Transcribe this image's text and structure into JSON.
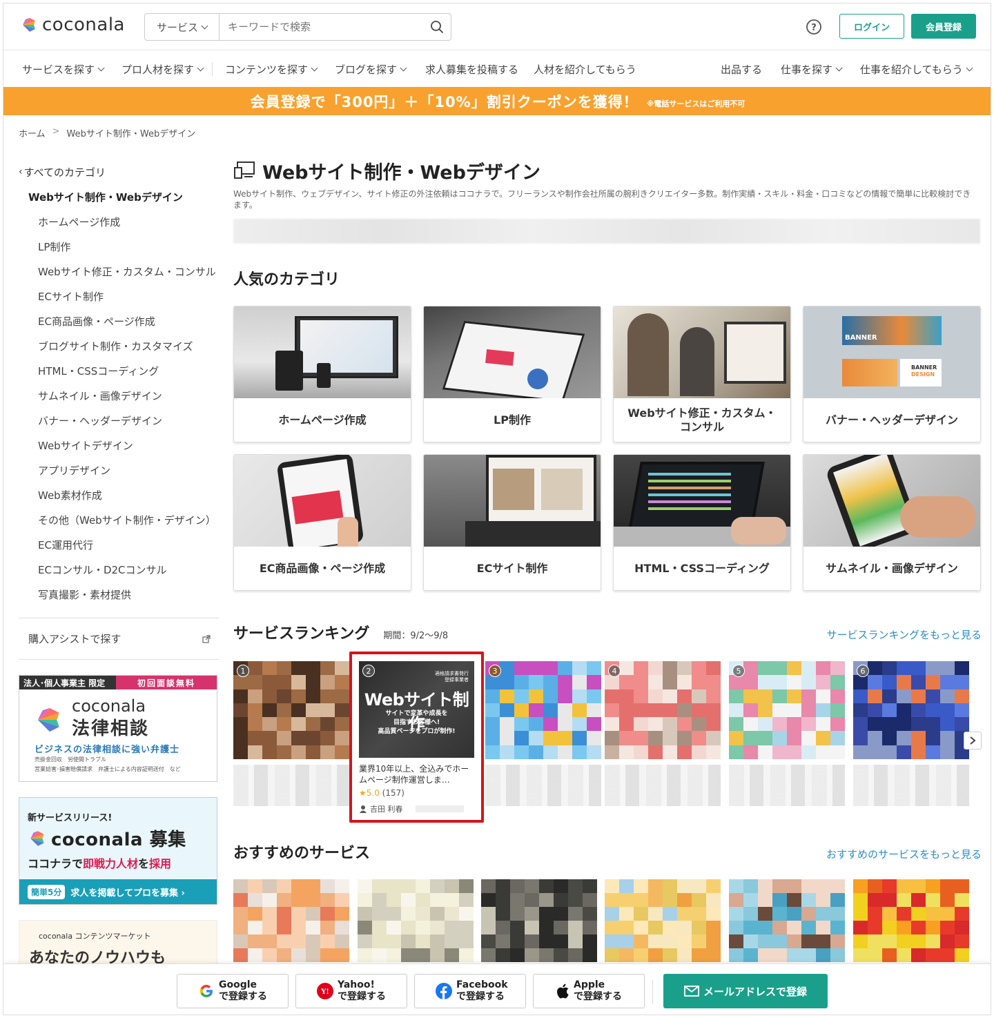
{
  "header": {
    "logo_text": "coconala",
    "search_category": "サービス",
    "search_placeholder": "キーワードで検索",
    "login_label": "ログイン",
    "signup_label": "会員登録"
  },
  "nav": {
    "items": [
      "サービスを探す",
      "プロ人材を探す",
      "コンテンツを探す",
      "ブログを探す",
      "求人募集を投稿する",
      "人材を紹介してもらう"
    ],
    "right_items": [
      "出品する",
      "仕事を探す",
      "仕事を紹介してもらう"
    ]
  },
  "promo": {
    "main": "会員登録で「300円」＋「10%」割引クーポンを獲得！",
    "note": "※電話サービスはご利用不可"
  },
  "breadcrumb": {
    "home": "ホーム",
    "sep": ">",
    "current": "Webサイト制作・Webデザイン"
  },
  "sidebar": {
    "back": "すべてのカテゴリ",
    "current": "Webサイト制作・Webデザイン",
    "items": [
      "ホームページ作成",
      "LP制作",
      "Webサイト修正・カスタム・コンサル",
      "ECサイト制作",
      "EC商品画像・ページ作成",
      "ブログサイト制作・カスタマイズ",
      "HTML・CSSコーディング",
      "サムネイル・画像デザイン",
      "バナー・ヘッダーデザイン",
      "Webサイトデザイン",
      "アプリデザイン",
      "Web素材作成",
      "その他（Webサイト制作・デザイン）",
      "EC運用代行",
      "ECコンサル・D2Cコンサル",
      "写真撮影・素材提供"
    ],
    "assist": "購入アシストで探す"
  },
  "ads": {
    "legal": {
      "tag_left": "法人･個人事業主 限定",
      "tag_right": "初回面談無料",
      "brand": "coconala",
      "title": "法律相談",
      "sub": "ビジネスの法律相談に強い弁護士",
      "small1": "売掛金回収　労使間トラブル",
      "small2": "営業妨害･損害賠償請求　弁護士による内容証明送付　など"
    },
    "recruit": {
      "t1": "新サービスリリース!",
      "brand": "coconala 募集",
      "t2_a": "ココナラで",
      "t2_b": "即戦力人材",
      "t2_c": "を",
      "t2_d": "採用",
      "pill": "簡単5分",
      "bar": "求人を掲載してプロを募集 ›"
    },
    "content": {
      "t1": "coconala コンテンツマーケット",
      "t2": "あなたのノウハウも"
    }
  },
  "main": {
    "title": "Webサイト制作・Webデザイン",
    "description": "Webサイト制作、ウェブデザイン、サイト修正の外注依頼はココナラで。フリーランスや制作会社所属の腕利きクリエイター多数。制作実績・スキル・料金・口コミなどの情報で簡単に比較検討できます。",
    "popular_title": "人気のカテゴリ",
    "categories": [
      "ホームページ作成",
      "LP制作",
      "Webサイト修正・カスタム・コンサル",
      "バナー・ヘッダーデザイン",
      "EC商品画像・ページ作成",
      "ECサイト制作",
      "HTML・CSSコーディング",
      "サムネイル・画像デザイン"
    ],
    "ranking_title": "サービスランキング",
    "ranking_period": "期間：9/2〜9/8",
    "ranking_more": "サービスランキングをもっと見る",
    "ranking_numbers": [
      "1",
      "2",
      "3",
      "4",
      "5",
      "6"
    ],
    "featured": {
      "tag": "適格請求書発行\n登録事業者",
      "headline": "Webサイト制作",
      "sub": "サイトで変革や成長を\n目指すお客様へ!\n高品質ページをプロが制作!",
      "title": "業界10年以上、全込みでホームページ制作運営しま…",
      "rating": "★5.0",
      "reviews": "(157)",
      "seller": "吉田 利春"
    },
    "recommend_title": "おすすめのサービス",
    "recommend_more": "おすすめのサービスをもっと見る"
  },
  "bottom": {
    "google": [
      "Google",
      "で登録する"
    ],
    "yahoo": [
      "Yahoo!",
      "で登録する"
    ],
    "facebook": [
      "Facebook",
      "で登録する"
    ],
    "apple": [
      "Apple",
      "で登録する"
    ],
    "mail": "メールアドレスで登録"
  },
  "colors": {
    "accent": "#1aa08a",
    "promo": "#f9a12e",
    "link": "#2a8cc8",
    "highlight": "#d4141c"
  }
}
